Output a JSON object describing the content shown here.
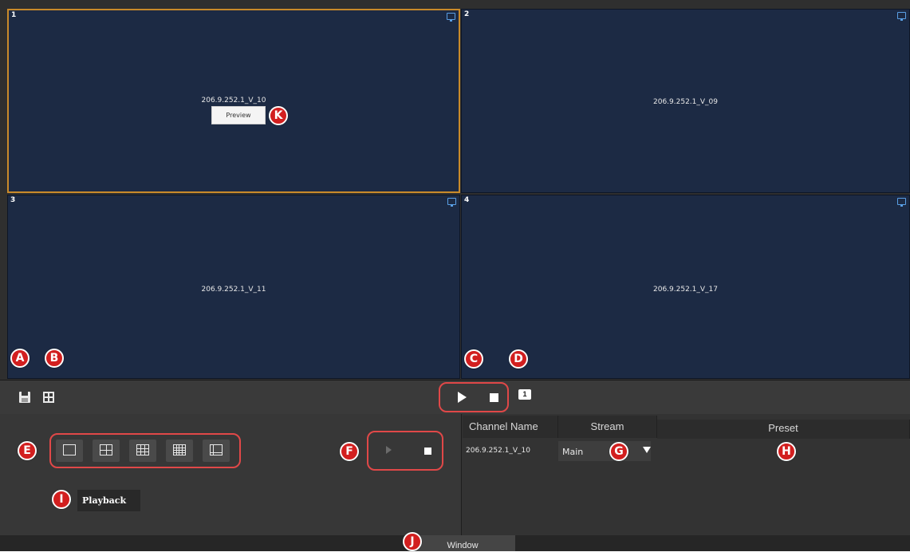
{
  "tiles": [
    {
      "number": "1",
      "channel": "206.9.252.1_V_10",
      "selected": true
    },
    {
      "number": "2",
      "channel": "206.9.252.1_V_09"
    },
    {
      "number": "3",
      "channel": "206.9.252.1_V_11"
    },
    {
      "number": "4",
      "channel": "206.9.252.1_V_17"
    }
  ],
  "preview_button": "Preview",
  "badges": {
    "a": "A",
    "b": "B",
    "c": "C",
    "d": "D",
    "e": "E",
    "f": "F",
    "g": "G",
    "h": "H",
    "i": "I",
    "j": "J",
    "k": "K"
  },
  "window_icon_label": "1",
  "playback_button": "Playback",
  "table": {
    "headers": {
      "channel_name": "Channel Name",
      "stream": "Stream",
      "preset": "Preset"
    },
    "row": {
      "channel_name": "206.9.252.1_V_10",
      "stream": "Main"
    }
  },
  "bottom_tab": "Window",
  "colors": {
    "tile_bg": "#1c2a44",
    "selected_border": "#c98a2a",
    "annotation": "#d21f1f",
    "highlight_outline": "#e04848"
  },
  "icons": {
    "save": "save-icon",
    "layout": "layout-icon",
    "play": "play-icon",
    "stop": "stop-icon",
    "window": "window-icon",
    "monitor": "monitor-icon",
    "dropdown": "chevron-down-icon"
  }
}
